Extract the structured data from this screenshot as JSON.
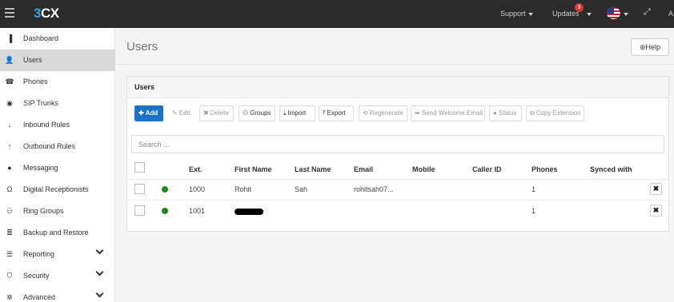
{
  "topbar": {
    "logo_main": "3",
    "logo_suffix": "CX",
    "support_label": "Support",
    "updates_label": "Updates",
    "updates_count": "3",
    "user_initial": "A"
  },
  "sidebar": {
    "items": [
      {
        "label": "Dashboard",
        "icon": "bar-chart-icon"
      },
      {
        "label": "Users",
        "icon": "user-icon",
        "active": true
      },
      {
        "label": "Phones",
        "icon": "phone-icon"
      },
      {
        "label": "SIP Trunks",
        "icon": "globe-icon"
      },
      {
        "label": "Inbound Rules",
        "icon": "arrow-down-icon"
      },
      {
        "label": "Outbound Rules",
        "icon": "arrow-up-icon"
      },
      {
        "label": "Messaging",
        "icon": "chat-icon"
      },
      {
        "label": "Digital Receptionists",
        "icon": "headset-icon"
      },
      {
        "label": "Ring Groups",
        "icon": "group-icon"
      },
      {
        "label": "Backup and Restore",
        "icon": "database-icon"
      },
      {
        "label": "Reporting",
        "icon": "list-icon"
      },
      {
        "label": "Security",
        "icon": "shield-icon"
      },
      {
        "label": "Advanced",
        "icon": "gear-icon"
      }
    ]
  },
  "header": {
    "title": "Users",
    "help_label": "Help"
  },
  "panel": {
    "title": "Users"
  },
  "toolbar": {
    "add": "Add",
    "edit": "Edit",
    "delete": "Delete",
    "groups": "Groups",
    "import": "Import",
    "export": "Export",
    "regenerate": "Regenerate",
    "send_welcome": "Send Welcome Email",
    "status": "Status",
    "copy_extension": "Copy Extension"
  },
  "search": {
    "placeholder": "Search ..."
  },
  "table": {
    "columns": [
      "Ext.",
      "First Name",
      "Last Name",
      "Email",
      "Mobile",
      "Caller ID",
      "Phones",
      "Synced with"
    ],
    "rows": [
      {
        "ext": "1000",
        "first_name": "Rohit",
        "last_name": "Sah",
        "email": "rohitsah07...",
        "mobile": "",
        "caller_id": "",
        "phones": "1",
        "synced_with": "",
        "status_color": "#1e8a1e"
      },
      {
        "ext": "1001",
        "first_name": "",
        "last_name": "",
        "email": "",
        "mobile": "",
        "caller_id": "",
        "phones": "1",
        "synced_with": "",
        "status_color": "#1e8a1e"
      }
    ]
  },
  "colors": {
    "accent": "#1a73c8",
    "topbar": "#2b2b2b",
    "status_online": "#1e8a1e"
  }
}
